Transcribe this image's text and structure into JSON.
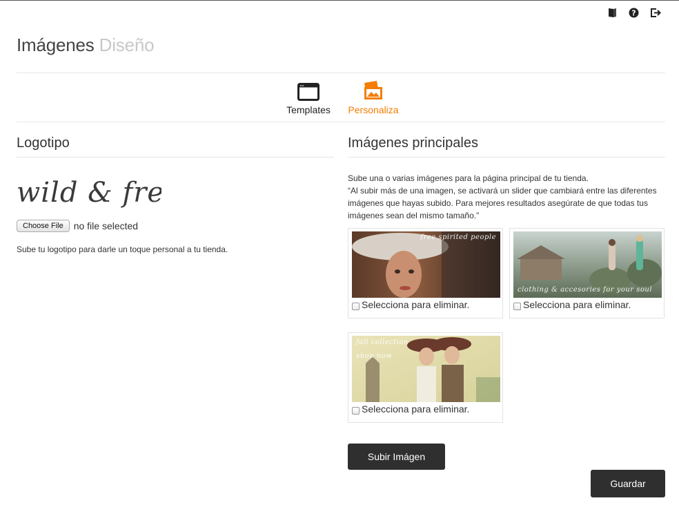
{
  "header": {
    "title_main": "Imágenes",
    "title_sub": "Diseño",
    "icons": [
      "book-icon",
      "help-icon",
      "logout-icon"
    ]
  },
  "tabs": [
    {
      "label": "Templates",
      "icon": "browser-window-icon",
      "active": false
    },
    {
      "label": "Personaliza",
      "icon": "images-icon",
      "active": true
    }
  ],
  "logo_section": {
    "title": "Logotipo",
    "logo_text": "wild & free",
    "file_button": "Choose File",
    "file_status": "no file selected",
    "help": "Sube tu logotipo para darle un toque personal a tu tienda."
  },
  "images_section": {
    "title": "Imágenes principales",
    "desc_line1": "Sube una o varias imágenes para la página principal de tu tienda.",
    "desc_line2": "“Al subir más de una imagen, se activará un slider que cambiará entre las diferentes imágenes que hayas subido. Para mejores resultados asegúrate de que todas tus imágenes sean del mismo tamaño.”",
    "images": [
      {
        "overlay": "free spirited people",
        "checkbox_label": "Selecciona para eliminar."
      },
      {
        "overlay": "clothing & accesories for your soul",
        "checkbox_label": "Selecciona para eliminar."
      },
      {
        "overlay_line1": "fall collection",
        "overlay_line2": "shop now",
        "checkbox_label": "Selecciona para eliminar."
      }
    ],
    "upload_button": "Subir Imágen"
  },
  "save_button": "Guardar",
  "colors": {
    "accent": "#f57c00",
    "dark_button": "#2f2f2f",
    "divider": "#e6e6e6"
  }
}
